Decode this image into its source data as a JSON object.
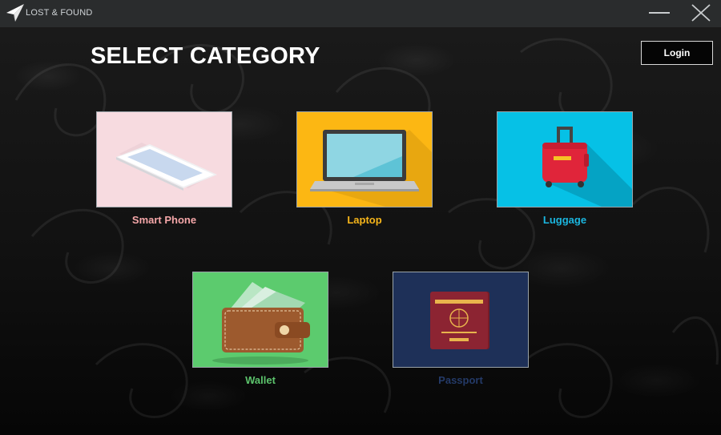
{
  "window": {
    "title": "LOST & FOUND",
    "logo_icon": "paper-plane-icon",
    "controls": [
      "minimize-icon",
      "close-icon"
    ]
  },
  "header": {
    "heading": "SELECT CATEGORY",
    "login_label": "Login"
  },
  "categories": [
    {
      "label": "Smart Phone",
      "icon": "smartphone-icon",
      "bg_color": "#f7dbe0",
      "label_color": "#f4a6a8"
    },
    {
      "label": "Laptop",
      "icon": "laptop-icon",
      "bg_color": "#fcb713",
      "label_color": "#f6b51a"
    },
    {
      "label": "Luggage",
      "icon": "luggage-icon",
      "bg_color": "#06c1e6",
      "label_color": "#1bb6df"
    },
    {
      "label": "Wallet",
      "icon": "wallet-icon",
      "bg_color": "#5ccb6e",
      "label_color": "#5cc36c"
    },
    {
      "label": "Passport",
      "icon": "passport-icon",
      "bg_color": "#1e3058",
      "label_color": "#243a68"
    }
  ]
}
